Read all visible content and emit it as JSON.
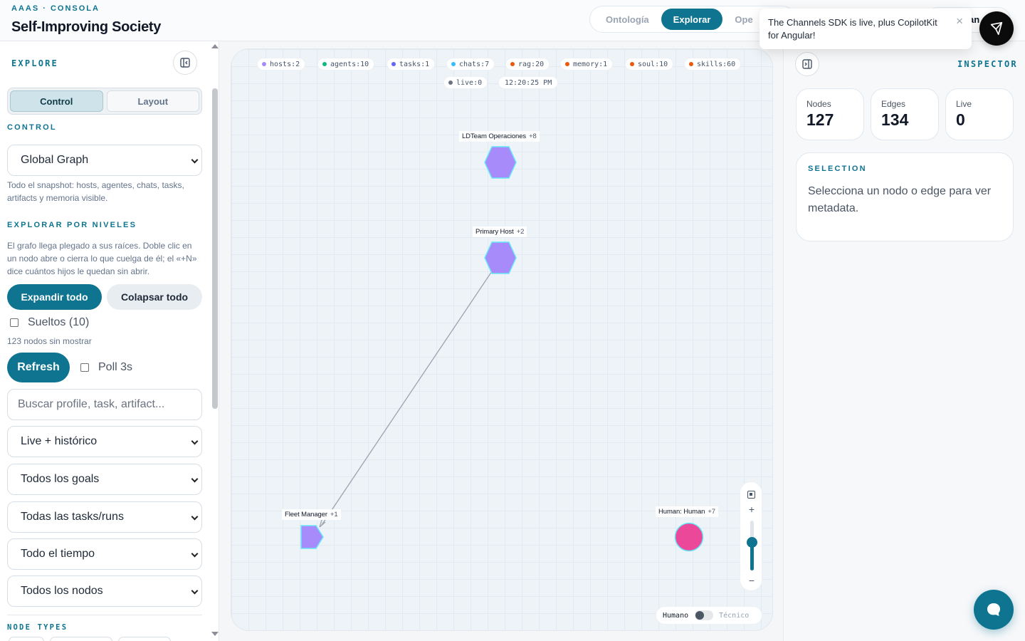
{
  "header": {
    "eyebrow": "AAAS · CONSOLA",
    "title": "Self-Improving Society",
    "tabs": [
      {
        "label": "Ontología",
        "active": false
      },
      {
        "label": "Explorar",
        "active": true
      },
      {
        "label": "Ope",
        "active": false
      }
    ],
    "right_pill_partial": "an"
  },
  "toast": {
    "message": "The Channels SDK is live, plus CopilotKit for Angular!",
    "close_glyph": "×"
  },
  "sidebar": {
    "title": "EXPLORE",
    "segmented": {
      "control": "Control",
      "layout": "Layout"
    },
    "control_heading": "CONTROL",
    "graph_select": "Global Graph",
    "graph_help": "Todo el snapshot: hosts, agentes, chats, tasks, artifacts y memoria visible.",
    "levels_heading": "EXPLORAR POR NIVELES",
    "levels_help": "El grafo llega plegado a sus raíces. Doble clic en un nodo abre o cierra lo que cuelga de él; el «+N» dice cuántos hijos le quedan sin abrir.",
    "expand_all": "Expandir todo",
    "collapse_all": "Colapsar todo",
    "loose_label": "Sueltos (10)",
    "hidden_nodes": "123 nodos sin mostrar",
    "refresh": "Refresh",
    "poll_label": "Poll 3s",
    "search_placeholder": "Buscar profile, task, artifact...",
    "filters": [
      "Live + histórico",
      "Todos los goals",
      "Todas las tasks/runs",
      "Todo el tiempo",
      "Todos los nodos"
    ],
    "node_types_heading": "NODE TYPES"
  },
  "canvas": {
    "counters": [
      {
        "label": "hosts:2",
        "color": "#a78bfa"
      },
      {
        "label": "agents:10",
        "color": "#10b981"
      },
      {
        "label": "tasks:1",
        "color": "#6366f1"
      },
      {
        "label": "chats:7",
        "color": "#38bdf8"
      },
      {
        "label": "rag:20",
        "color": "#ea580c"
      },
      {
        "label": "memory:1",
        "color": "#ea580c"
      },
      {
        "label": "soul:10",
        "color": "#ea580c"
      },
      {
        "label": "skills:60",
        "color": "#ea580c"
      },
      {
        "label": "live:0",
        "color": "#6b7280"
      }
    ],
    "clock": "12:20:25 PM",
    "nodes": [
      {
        "name": "LDTeam Operaciones",
        "count": "+8",
        "shape": "hexagon",
        "color": "#a78bfa"
      },
      {
        "name": "Primary Host",
        "count": "+2",
        "shape": "hexagon",
        "color": "#a78bfa"
      },
      {
        "name": "Fleet Manager",
        "count": "+1",
        "shape": "pentagon",
        "color": "#a78bfa"
      },
      {
        "name": "Human: Human",
        "count": "+7",
        "shape": "circle",
        "color": "#ec4899"
      }
    ],
    "zoom_level": 0.57,
    "mode_toggle": {
      "left": "Humano",
      "right": "Técnico"
    }
  },
  "inspector": {
    "title": "INSPECTOR",
    "stats": [
      {
        "label": "Nodes",
        "value": "127"
      },
      {
        "label": "Edges",
        "value": "134"
      },
      {
        "label": "Live",
        "value": "0"
      }
    ],
    "selection_title": "SELECTION",
    "selection_text": "Selecciona un nodo o edge para ver metadata."
  },
  "colors": {
    "accent": "#0e7490",
    "host": "#a78bfa",
    "human": "#ec4899"
  }
}
